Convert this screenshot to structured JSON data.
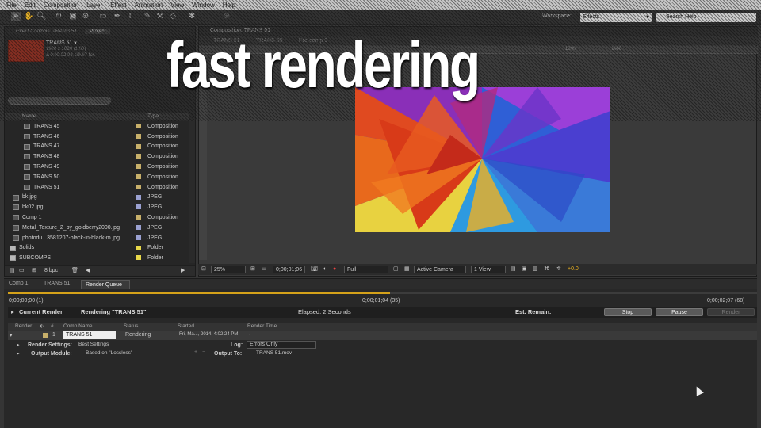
{
  "menu": [
    "File",
    "Edit",
    "Composition",
    "Layer",
    "Effect",
    "Animation",
    "View",
    "Window",
    "Help"
  ],
  "workspace": {
    "label": "Workspace:",
    "value": "Effects"
  },
  "search": {
    "placeholder": "Search Help"
  },
  "project": {
    "tabs": [
      "Effect Controls: TRANS 51",
      "Project"
    ],
    "selected": {
      "name": "TRANS 51 ▾",
      "dims": "1920 x 1080 (1.00)",
      "duration": "Δ 0;00;02;08, 29.97 fps"
    },
    "columns": {
      "name": "Name",
      "type": "Type"
    },
    "items": [
      {
        "name": "TRANS 45",
        "type": "Composition",
        "color": "#c8b06a",
        "icon": "composition-icon",
        "indent": 2
      },
      {
        "name": "TRANS 46",
        "type": "Composition",
        "color": "#c8b06a",
        "icon": "composition-icon",
        "indent": 2
      },
      {
        "name": "TRANS 47",
        "type": "Composition",
        "color": "#c8b06a",
        "icon": "composition-icon",
        "indent": 2
      },
      {
        "name": "TRANS 48",
        "type": "Composition",
        "color": "#c8b06a",
        "icon": "composition-icon",
        "indent": 2
      },
      {
        "name": "TRANS 49",
        "type": "Composition",
        "color": "#c8b06a",
        "icon": "composition-icon",
        "indent": 2
      },
      {
        "name": "TRANS 50",
        "type": "Composition",
        "color": "#c8b06a",
        "icon": "composition-icon",
        "indent": 2
      },
      {
        "name": "TRANS 51",
        "type": "Composition",
        "color": "#c8b06a",
        "icon": "composition-icon",
        "indent": 2
      },
      {
        "name": "bk.jpg",
        "type": "JPEG",
        "color": "#9aa0d0",
        "icon": "image-icon",
        "indent": 1
      },
      {
        "name": "bk02.jpg",
        "type": "JPEG",
        "color": "#9aa0d0",
        "icon": "image-icon",
        "indent": 1
      },
      {
        "name": "Comp 1",
        "type": "Composition",
        "color": "#c8b06a",
        "icon": "composition-icon",
        "indent": 1
      },
      {
        "name": "Metal_Texture_2_by_goldberry2000.jpg",
        "type": "JPEG",
        "color": "#9aa0d0",
        "icon": "image-icon",
        "indent": 1
      },
      {
        "name": "photodu...3581207-black-in-black-m.jpg",
        "type": "JPEG",
        "color": "#9aa0d0",
        "icon": "image-icon",
        "indent": 1
      },
      {
        "name": "Solids",
        "type": "Folder",
        "color": "#e8d84a",
        "icon": "folder-icon",
        "indent": 0
      },
      {
        "name": "SUBCOMPS",
        "type": "Folder",
        "color": "#e8d84a",
        "icon": "folder-icon",
        "indent": 0
      }
    ],
    "bpc": "8 bpc"
  },
  "comp": {
    "tab": "Composition: TRANS 51",
    "breadcrumbs": [
      "TRANS 51",
      "TRANS 50",
      "Pre-comp 9"
    ],
    "ruler_ticks": [
      "1800",
      "1900"
    ],
    "overlay_title": "fast rendering",
    "viewer": {
      "zoom": "25%",
      "timecode": "0;00;01;06",
      "resolution": "Full",
      "camera": "Active Camera",
      "views": "1 View",
      "exposure": "+0.0"
    }
  },
  "render_queue": {
    "tabs": [
      "Comp 1",
      "TRANS 51",
      "Render Queue"
    ],
    "time_start": "0;00;00;00 (1)",
    "time_current": "0;00;01;04 (35)",
    "time_end": "0;00;02;07 (68)",
    "progress": 0.51,
    "current_render_label": "Current Render",
    "rendering_label": "Rendering \"TRANS 51\"",
    "elapsed": "Elapsed: 2 Seconds",
    "est_remain": "Est. Remain:",
    "buttons": {
      "stop": "Stop",
      "pause": "Pause",
      "render": "Render"
    },
    "columns": [
      "Render",
      "#",
      "Comp Name",
      "Status",
      "Started",
      "Render Time"
    ],
    "item": {
      "num": "1",
      "comp": "TRANS 51",
      "status": "Rendering",
      "started": "Fri, Ma..., 2014, 4:02:24 PM",
      "render_time": "-"
    },
    "settings": {
      "label": "Render Settings:",
      "value": "Best Settings",
      "log_label": "Log:",
      "log_value": "Errors Only"
    },
    "output": {
      "label": "Output Module:",
      "value": "Based on \"Lossless\"",
      "to_label": "Output To:",
      "to_value": "TRANS 51.mov"
    }
  }
}
